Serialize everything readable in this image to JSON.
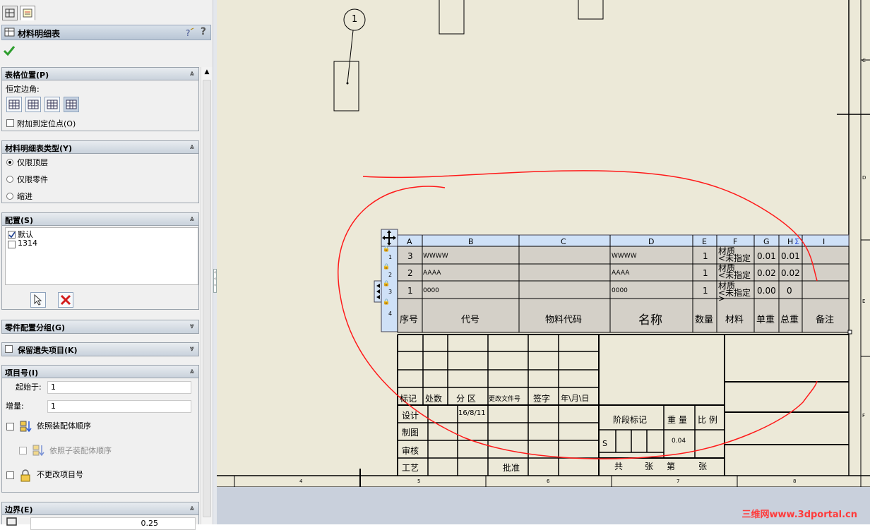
{
  "panel": {
    "title": "材料明细表",
    "help_label": "?",
    "sections": {
      "table_position": {
        "header": "表格位置(P)",
        "anchor_label": "恒定边角:",
        "attach_label": "附加到定位点(O)"
      },
      "bom_type": {
        "header": "材料明细表类型(Y)",
        "options": [
          "仅限顶层",
          "仅限零件",
          "缩进"
        ]
      },
      "configurations": {
        "header": "配置(S)",
        "items": [
          {
            "label": "默认",
            "checked": true
          },
          {
            "label": "1314",
            "checked": false
          }
        ]
      },
      "part_config_grouping": {
        "header": "零件配置分组(G)"
      },
      "keep_missing": {
        "header": "保留遗失项目(K)"
      },
      "item_numbers": {
        "header": "项目号(I)",
        "start_label": "起始于:",
        "start_value": "1",
        "increment_label": "增量:",
        "increment_value": "1",
        "follow_assembly_order": "依照装配体顺序",
        "follow_subassembly_order": "依照子装配体顺序",
        "do_not_change": "不更改项目号"
      },
      "border": {
        "header": "边界(E)",
        "value": "0.25"
      }
    }
  },
  "drawing": {
    "balloon": "1",
    "bom": {
      "col_letters": [
        "A",
        "B",
        "C",
        "D",
        "E",
        "F",
        "G",
        "H",
        "I"
      ],
      "row_indices": [
        "1",
        "2",
        "3",
        "4"
      ],
      "rows": [
        {
          "no": "3",
          "code": "WWWW",
          "material_code": "",
          "name": "WWWW",
          "qty": "1",
          "mat_line1": "材质",
          "mat_line2": "<未指定",
          "unit": "0.01",
          "total": "0.01"
        },
        {
          "no": "2",
          "code": "AAAA",
          "material_code": "",
          "name": "AAAA",
          "qty": "1",
          "mat_line1": "材质",
          "mat_line2": "<未指定",
          "unit": "0.02",
          "total": "0.02"
        },
        {
          "no": "1",
          "code": "0000",
          "material_code": "",
          "name": "0000",
          "qty": "1",
          "mat_line1": "材质",
          "mat_line2": "<未指定",
          "unit": "0.00",
          "total": "0"
        }
      ],
      "header": {
        "no": "序号",
        "code": "代号",
        "material_code": "物料代码",
        "name": "名称",
        "qty": "数量",
        "material": "材料",
        "unit": "单重",
        "total": "总重",
        "remark": "备注"
      },
      "tail_char": ">"
    },
    "title_block": {
      "mark": "标记",
      "count": "处数",
      "zone": "分 区",
      "change_doc": "更改文件号",
      "sign": "签字",
      "date_hdr": "年\\月\\日",
      "design": "设计",
      "design_date": "16/8/11",
      "drawing": "制图",
      "check": "审核",
      "process": "工艺",
      "approve": "批准",
      "stage": "阶段标记",
      "weight": "重 量",
      "scale": "比 例",
      "stage_value": "S",
      "weight_value": "0.04",
      "total_sheets": "共",
      "sheets": "张",
      "sheet_no": "第",
      "sheet_end": "张"
    },
    "border_numbers": [
      "4",
      "5",
      "6",
      "7",
      "8"
    ],
    "side_letters": [
      "C",
      "D",
      "E",
      "F"
    ]
  },
  "watermark": "三维网www.3dportal.cn"
}
